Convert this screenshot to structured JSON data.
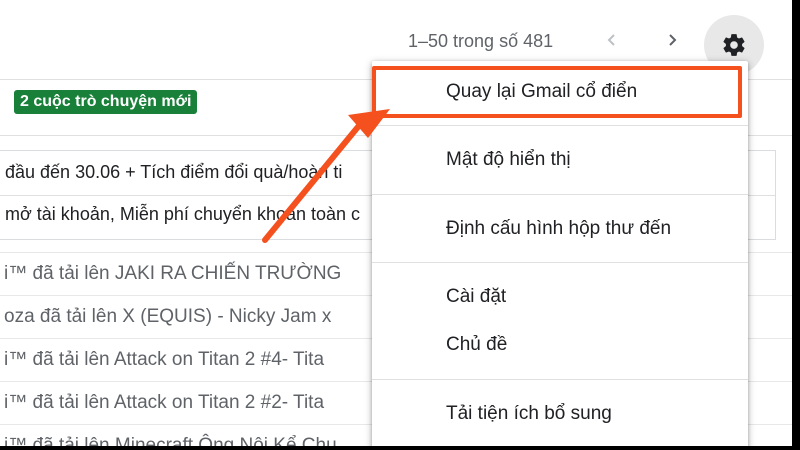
{
  "header": {
    "pager_text": "1–50 trong số 481",
    "prev_icon": "chevron-left-icon",
    "next_icon": "chevron-right-icon",
    "settings_icon": "gear-icon"
  },
  "inbox": {
    "new_conversations_badge": "2 cuộc trò chuyện mới",
    "promo_lines": [
      "đầu đến 30.06 + Tích điểm đổi quà/hoàn ti",
      "mở tài khoản, Miễn phí chuyển khoản toàn c"
    ],
    "rows": [
      "i™ đã tải lên JAKI RA CHIẾN TRƯỜNG",
      "oza đã tải lên X (EQUIS) - Nicky Jam x",
      "i™ đã tải lên Attack on Titan 2 #4- Tita",
      "i™ đã tải lên Attack on Titan 2 #2- Tita",
      "i™ đã tải lên Minecraft Ông Nội Kể Chu"
    ]
  },
  "menu": {
    "items": [
      "Quay lại Gmail cổ điển",
      "Mật độ hiển thị",
      "Định cấu hình hộp thư đến",
      "Cài đặt",
      "Chủ đề",
      "Tải tiện ích bổ sung"
    ]
  },
  "colors": {
    "highlight": "#f4511e",
    "badge": "#188038"
  }
}
